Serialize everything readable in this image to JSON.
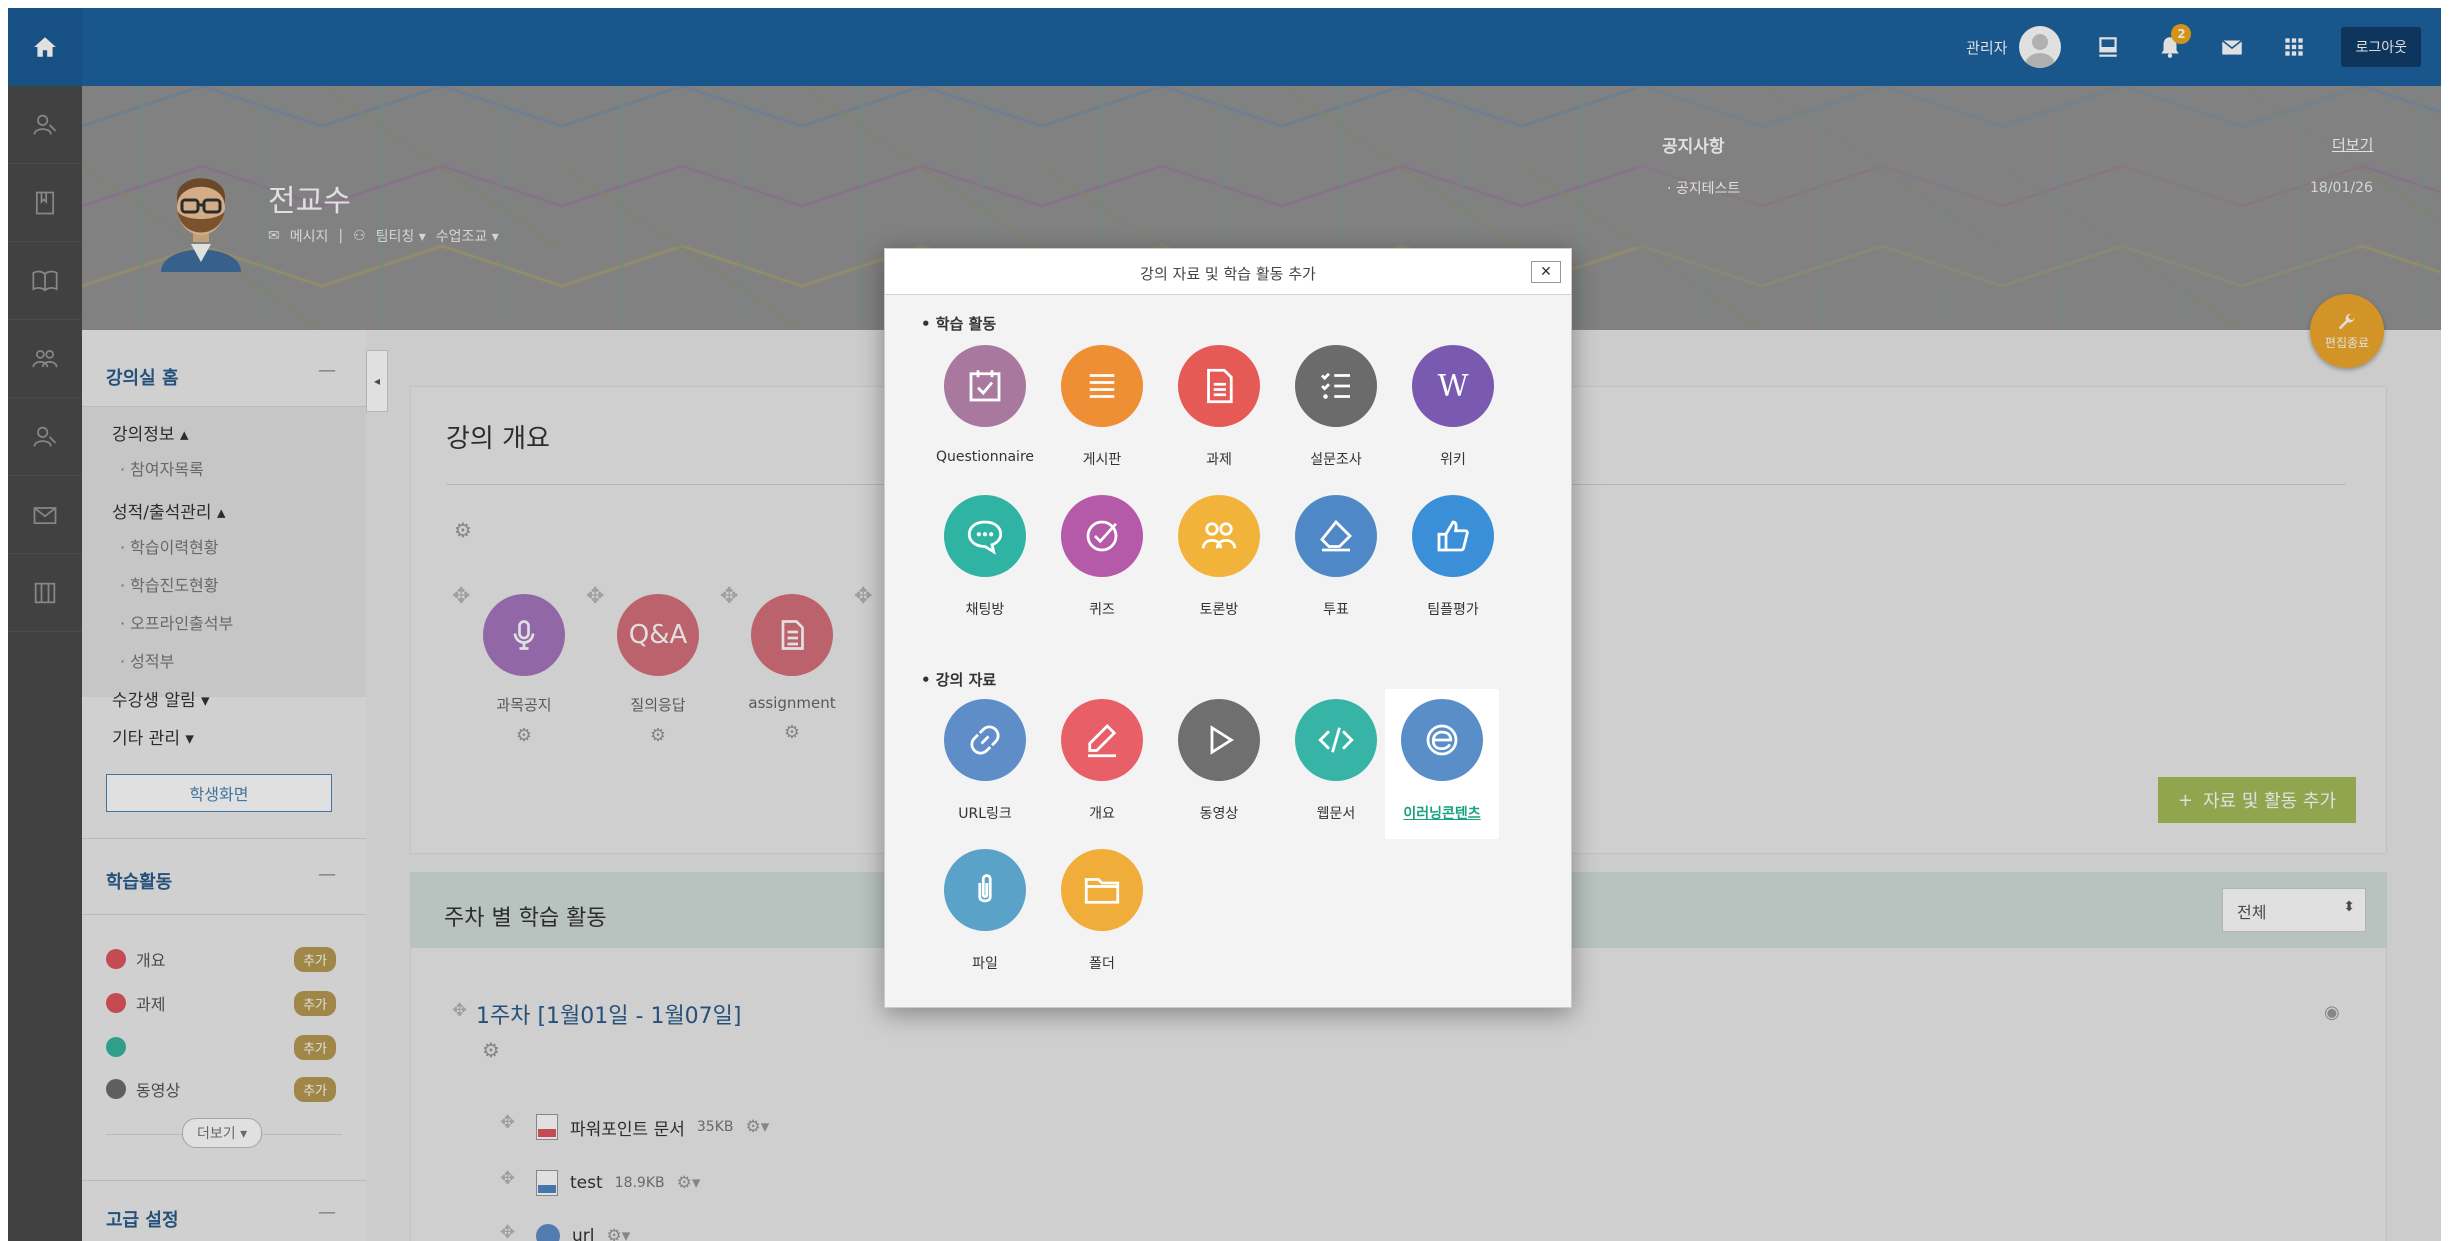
{
  "topbar": {
    "user_label": "관리자",
    "notification_count": "2",
    "logout_label": "로그아웃"
  },
  "profile": {
    "name": "전교수",
    "links": [
      "메시지",
      "팀티칭 ▾",
      "수업조교 ▾"
    ]
  },
  "notice": {
    "title": "공지사항",
    "more": "더보기",
    "items": [
      {
        "title": "· 공지테스트",
        "date": "18/01/26"
      }
    ]
  },
  "edit_button": "편집종료",
  "sidebar": {
    "home": "강의실 홈",
    "course_info": "강의정보 ▴",
    "participants": "· 참여자목록",
    "grades_attendance": "성적/출석관리 ▴",
    "grade_items": [
      "· 학습이력현황",
      "· 학습진도현황",
      "· 오프라인출석부",
      "· 성적부"
    ],
    "student_alert": "수강생 알림 ▾",
    "other_admin": "기타 관리 ▾",
    "student_view": "학생화면",
    "activities_title": "학습활동",
    "activities": [
      {
        "label": "개요",
        "color": "#e0565e",
        "add": "추가"
      },
      {
        "label": "과제",
        "color": "#e0565e",
        "add": "추가"
      },
      {
        "label": "",
        "color": "#36b5a0",
        "add": "추가"
      },
      {
        "label": "동영상",
        "color": "#6d6d6d",
        "add": "추가"
      }
    ],
    "more": "더보기 ▾",
    "advanced": "고급 설정"
  },
  "overview": {
    "title": "강의 개요",
    "items": [
      {
        "label": "과목공지",
        "color": "#a776c0"
      },
      {
        "label": "질의응답",
        "color": "#d6707c",
        "text": "Q&A"
      },
      {
        "label": "assignment",
        "color": "#d6707c"
      }
    ],
    "add_button": "자료 및 활동 추가"
  },
  "weekly": {
    "title": "주차 별 학습 활동",
    "filter": "전체",
    "week1": "1주차 [1월01일 - 1월07일]",
    "files": [
      {
        "name": "파워포인트 문서",
        "size": "35KB"
      },
      {
        "name": "test",
        "size": "18.9KB"
      },
      {
        "name": "url",
        "size": ""
      }
    ]
  },
  "modal": {
    "title": "강의 자료 및 학습 활동 추가",
    "close": "✕",
    "section_activities": "• 학습 활동",
    "section_resources": "• 강의 자료",
    "activities": [
      {
        "label": "Questionnaire",
        "color": "#a8789e",
        "icon": "calendar-check-icon"
      },
      {
        "label": "게시판",
        "color": "#ef8f35",
        "icon": "list-icon"
      },
      {
        "label": "과제",
        "color": "#e65a55",
        "icon": "document-icon"
      },
      {
        "label": "설문조사",
        "color": "#6b6b6b",
        "icon": "checklist-icon"
      },
      {
        "label": "위키",
        "color": "#7a5ab0",
        "icon": "wiki-icon"
      },
      {
        "label": "채팅방",
        "color": "#2fb3a3",
        "icon": "chat-icon"
      },
      {
        "label": "퀴즈",
        "color": "#b45aa8",
        "icon": "check-circle-icon"
      },
      {
        "label": "토론방",
        "color": "#f1b33a",
        "icon": "people-icon"
      },
      {
        "label": "투표",
        "color": "#4f88c6",
        "icon": "eraser-icon"
      },
      {
        "label": "팀플평가",
        "color": "#3b8fd8",
        "icon": "thumbs-up-icon"
      }
    ],
    "resources": [
      {
        "label": "URL링크",
        "color": "#5e8dc8",
        "icon": "link-icon"
      },
      {
        "label": "개요",
        "color": "#e95f67",
        "icon": "pencil-icon"
      },
      {
        "label": "동영상",
        "color": "#6f6f6f",
        "icon": "play-icon"
      },
      {
        "label": "웹문서",
        "color": "#37b4a6",
        "icon": "code-icon"
      },
      {
        "label": "이러닝콘텐츠",
        "color": "#5a8ec8",
        "icon": "ie-icon"
      },
      {
        "label": "파일",
        "color": "#5aa2c8",
        "icon": "paperclip-icon"
      },
      {
        "label": "폴더",
        "color": "#f1ad39",
        "icon": "folder-icon"
      }
    ]
  }
}
